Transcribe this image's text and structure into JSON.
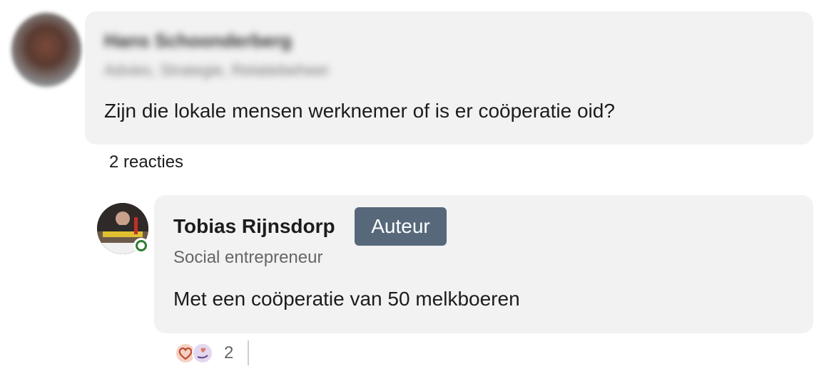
{
  "comment": {
    "author_name": "Hans Schoonderberg",
    "author_subtitle": "Advies, Strategie, Relatiebeheer",
    "text": "Zijn die lokale mensen werknemer of is er coöperatie oid?",
    "replies_count_label": "2 reacties"
  },
  "reply": {
    "author_name": "Tobias Rijnsdorp",
    "badge": "Auteur",
    "author_subtitle": "Social entrepreneur",
    "text": "Met een coöperatie van 50 melkboeren",
    "online_status_color": "#2e7d32",
    "reactions": {
      "icons": [
        "love-reaction-icon",
        "support-reaction-icon"
      ],
      "count": "2"
    }
  },
  "colors": {
    "bubble_bg": "#f2f2f2",
    "badge_bg": "#56687a"
  }
}
